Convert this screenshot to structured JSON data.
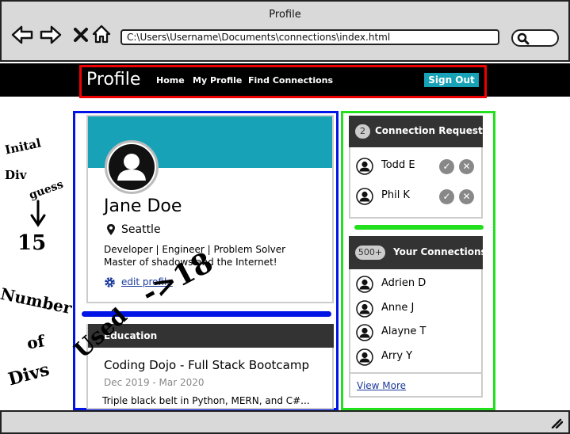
{
  "window": {
    "title": "Profile",
    "url": "C:\\Users\\Username\\Documents\\connections\\index.html"
  },
  "navbar": {
    "brand": "Profile",
    "links": [
      "Home",
      "My Profile",
      "Find Connections"
    ],
    "sign_out": "Sign Out"
  },
  "profile": {
    "name": "Jane Doe",
    "location": "Seattle",
    "bio_line1": "Developer | Engineer | Problem Solver",
    "bio_line2": "Master of shadows and the Internet!",
    "edit_label": "edit profile"
  },
  "education": {
    "title": "Education",
    "school": "Coding Dojo - Full Stack Bootcamp",
    "dates": "Dec 2019 - Mar 2020",
    "description": "Triple black belt in Python, MERN, and C#..."
  },
  "requests": {
    "count": "2",
    "title": "Connection Requests",
    "people": [
      "Todd E",
      "Phil K"
    ]
  },
  "connections": {
    "count": "500+",
    "title": "Your Connections",
    "people": [
      "Adrien D",
      "Anne J",
      "Alayne T",
      "Arry Y"
    ],
    "view_more": "View More"
  },
  "annotations": {
    "initial": [
      "Inital",
      "Div",
      "guess",
      "15"
    ],
    "number": [
      "Number",
      "of",
      "Divs"
    ],
    "used": "Used",
    "result": "->18"
  },
  "colors": {
    "navbar": "#000000",
    "accent": "#17a2b8",
    "red": "#ee0000",
    "blue": "#0014e6",
    "green": "#22e01c"
  }
}
